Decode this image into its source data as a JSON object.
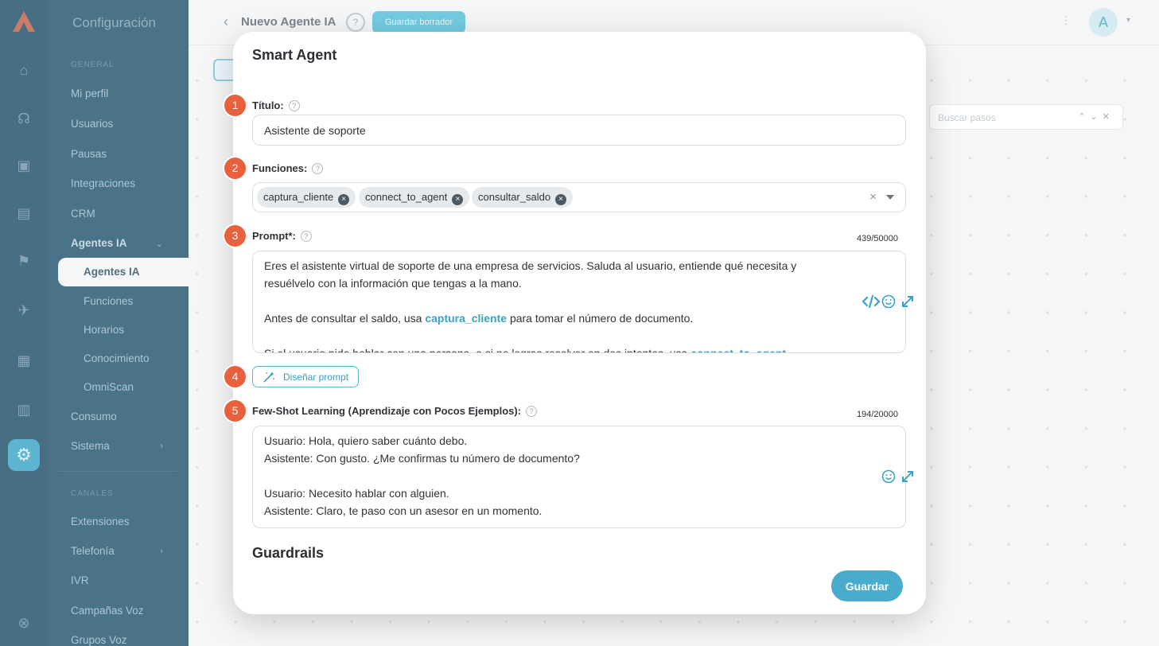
{
  "sidebar": {
    "title": "Configuración",
    "section_general": "GENERAL",
    "items": [
      "Mi perfil",
      "Usuarios",
      "Pausas",
      "Integraciones",
      "CRM",
      "Agentes IA"
    ],
    "subitems": [
      "Agentes IA",
      "Funciones",
      "Horarios",
      "Conocimiento",
      "OmniScan"
    ],
    "items2": [
      "Consumo",
      "Sistema"
    ],
    "section_channels": "CANALES",
    "items3": [
      "Extensiones",
      "Telefonía",
      "IVR",
      "Campañas Voz",
      "Grupos Voz"
    ]
  },
  "header": {
    "page_title": "Nuevo Agente IA",
    "help": "?",
    "draft_button": "Guardar borrador",
    "avatar_initial": "A"
  },
  "canvas": {
    "search_placeholder": "Buscar pasos"
  },
  "modal": {
    "title": "Smart Agent",
    "fields": {
      "titulo": {
        "number": "1",
        "label": "Título:",
        "value": "Asistente de soporte"
      },
      "funciones": {
        "number": "2",
        "label": "Funciones:",
        "tags": [
          "captura_cliente",
          "connect_to_agent",
          "consultar_saldo"
        ]
      },
      "prompt": {
        "number": "3",
        "label": "Prompt*:",
        "counter": "439/50000",
        "line1": "Eres el asistente virtual de soporte de una empresa de servicios. Saluda al usuario, entiende qué necesita y resuélvelo con la información que tengas a la mano.",
        "line2_pre": "Antes de consultar el saldo, usa ",
        "line2_fn": "captura_cliente",
        "line2_post": " para tomar el número de documento.",
        "line3_pre": "Si el usuario pide hablar con una persona, o si no logras resolver en dos intentos, usa ",
        "line3_fn": "connect_to_agent"
      },
      "design": {
        "number": "4",
        "label": "Diseñar prompt"
      },
      "fewshot": {
        "number": "5",
        "label": "Few-Shot Learning (Aprendizaje con Pocos Ejemplos):",
        "counter": "194/20000",
        "lines": [
          "Usuario: Hola, quiero saber cuánto debo.",
          "Asistente: Con gusto. ¿Me confirmas tu número de documento?",
          "",
          "Usuario: Necesito hablar con alguien.",
          "Asistente: Claro, te paso con un asesor en un momento."
        ]
      }
    },
    "guardrails_heading": "Guardrails",
    "save_button": "Guardar"
  },
  "colors": {
    "accent": "#4aaccc",
    "badge": "#e8613e",
    "sidebar": "#24556d"
  }
}
